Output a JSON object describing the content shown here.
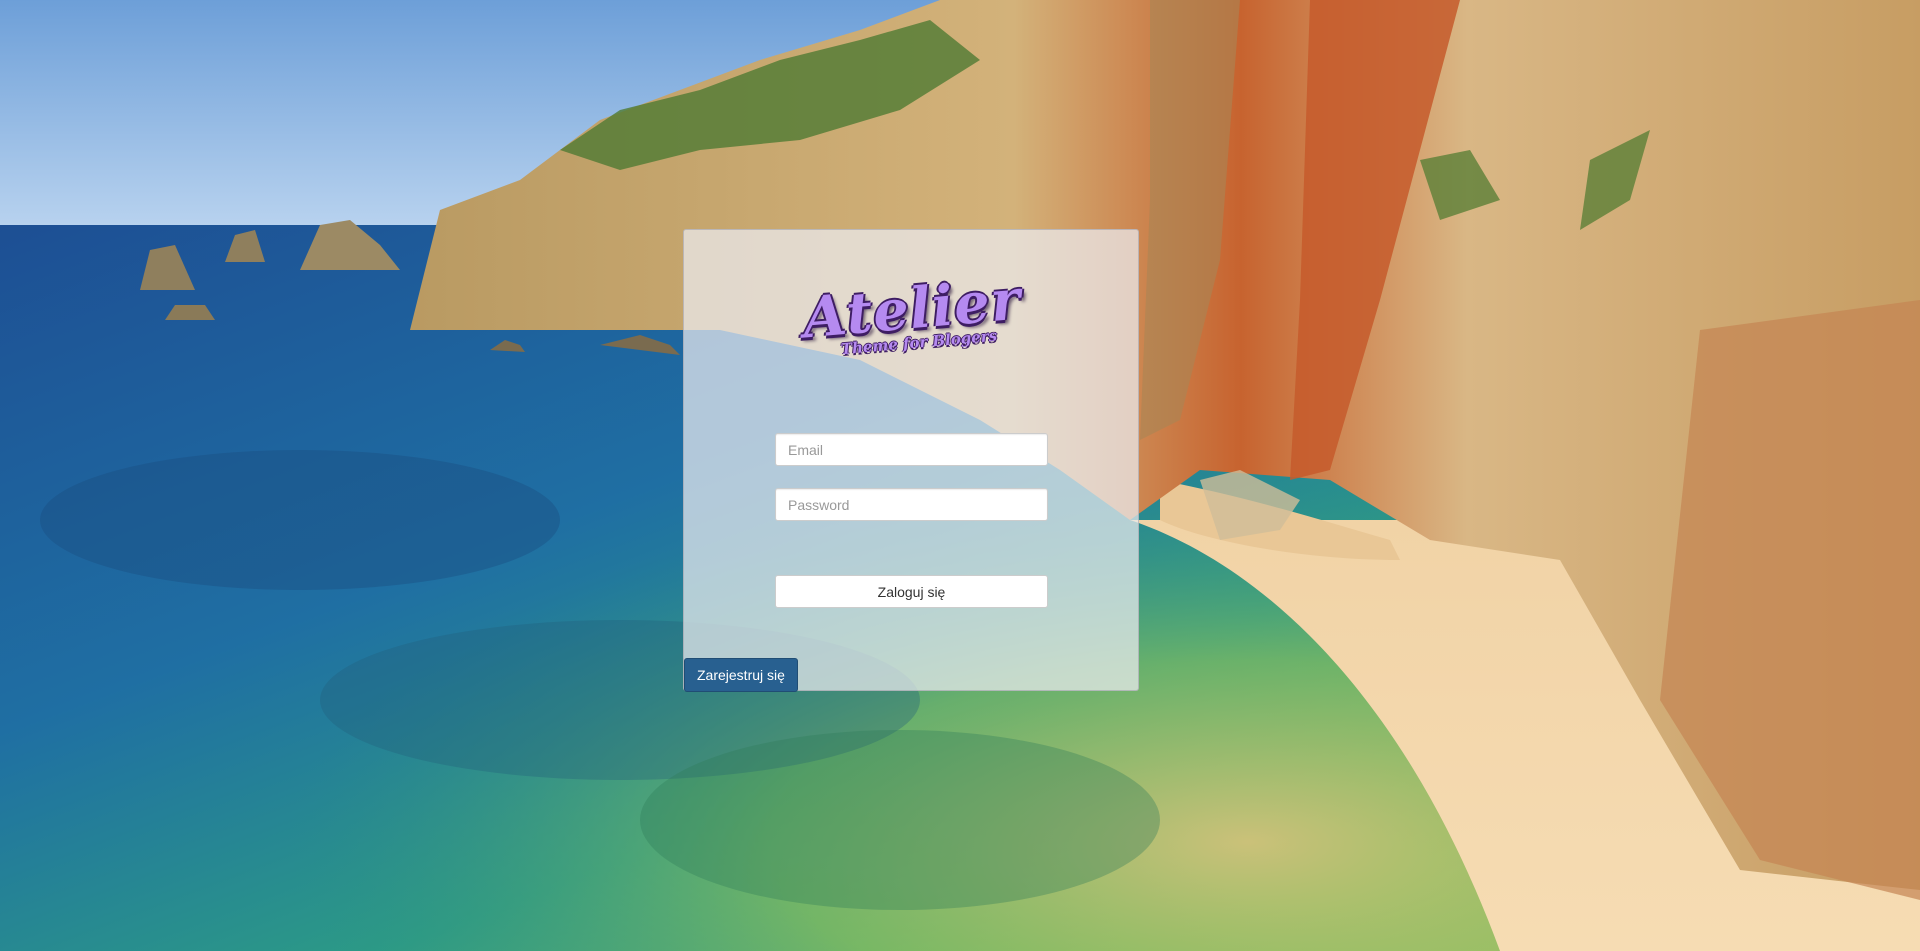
{
  "logo": {
    "title": "Atelier",
    "tagline": "Theme for Blogers"
  },
  "login_form": {
    "email_placeholder": "Email",
    "password_placeholder": "Password",
    "login_label": "Zaloguj się"
  },
  "register": {
    "label": "Zarejestruj się"
  }
}
